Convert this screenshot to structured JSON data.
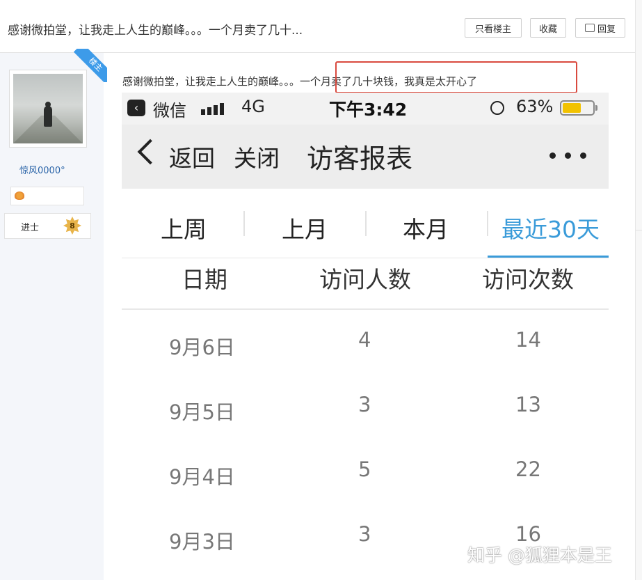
{
  "header": {
    "title": "感谢微拍堂，让我走上人生的巅峰。。。一个月卖了几十...",
    "buttons": {
      "only_author": "只看楼主",
      "favorite": "收藏",
      "reply": "回复"
    }
  },
  "user": {
    "badge": "楼主",
    "name": "惊风0000°",
    "rank": "进士",
    "level": "8"
  },
  "post": {
    "text": "感谢微拍堂，让我走上人生的巅峰。。。一个月卖了几十块钱，我真是太开心了"
  },
  "phone": {
    "status": {
      "app": "微信",
      "network": "4G",
      "time": "下午3:42",
      "battery": "63%",
      "battery_level": 0.63
    },
    "nav": {
      "back": "返回",
      "close": "关闭",
      "title": "访客报表"
    },
    "tabs": [
      "上周",
      "上月",
      "本月",
      "最近30天"
    ],
    "active_tab": "最近30天",
    "table": {
      "headers": [
        "日期",
        "访问人数",
        "访问次数"
      ],
      "rows": [
        {
          "date": "9月6日",
          "visitors": "4",
          "visits": "14"
        },
        {
          "date": "9月5日",
          "visitors": "3",
          "visits": "13"
        },
        {
          "date": "9月4日",
          "visitors": "5",
          "visits": "22"
        },
        {
          "date": "9月3日",
          "visitors": "3",
          "visits": "16"
        }
      ]
    }
  },
  "watermark": "知乎 @狐狸本是王",
  "colors": {
    "accent": "#3a9bd9",
    "highlight_border": "#d94a3f",
    "badge": "#3d9be9",
    "username": "#2a64a8"
  }
}
